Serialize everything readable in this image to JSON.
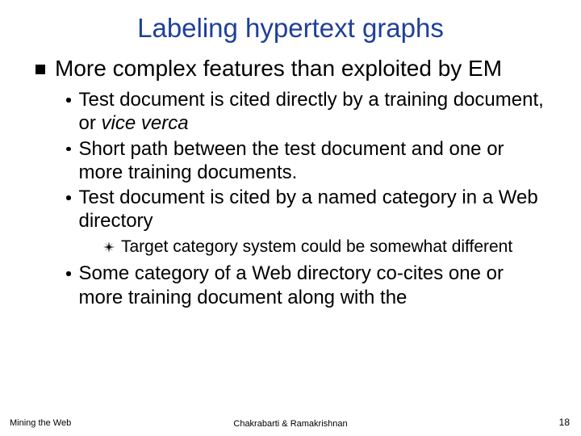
{
  "title": "Labeling hypertext graphs",
  "lvl1": "More complex features than exploited by EM",
  "sub": {
    "a_pre": "Test document is cited directly by a training document, or ",
    "a_ital": "vice verca",
    "b": "Short path between the test document and one or more training documents.",
    "c": "Test document is cited by a named category in a Web directory",
    "c_sub": "Target category system could be somewhat different",
    "d": "Some category of a Web directory co-cites one or more training document along with the"
  },
  "footer": {
    "left": "Mining the Web",
    "center": "Chakrabarti & Ramakrishnan",
    "right": "18"
  }
}
